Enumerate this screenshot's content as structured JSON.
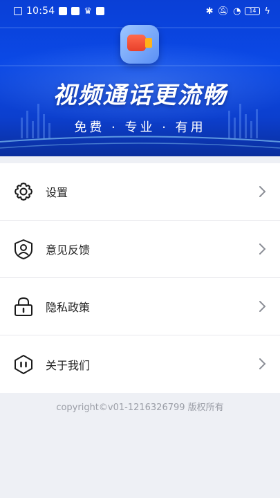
{
  "status_bar": {
    "time": "10:54",
    "battery": "14"
  },
  "banner": {
    "title": "视频通话更流畅",
    "subtitle": "免费 · 专业 · 有用",
    "app_icon": "video-camera-icon"
  },
  "menu": {
    "items": [
      {
        "label": "设置",
        "icon": "gear-icon"
      },
      {
        "label": "意见反馈",
        "icon": "feedback-icon"
      },
      {
        "label": "隐私政策",
        "icon": "lock-icon"
      },
      {
        "label": "关于我们",
        "icon": "about-icon"
      }
    ]
  },
  "footer": {
    "copyright": "copyright©v01-1216326799 版权所有"
  },
  "colors": {
    "banner_blue": "#0b49e6",
    "background": "#eef0f5",
    "text": "#222222",
    "muted": "#9a9da6"
  }
}
